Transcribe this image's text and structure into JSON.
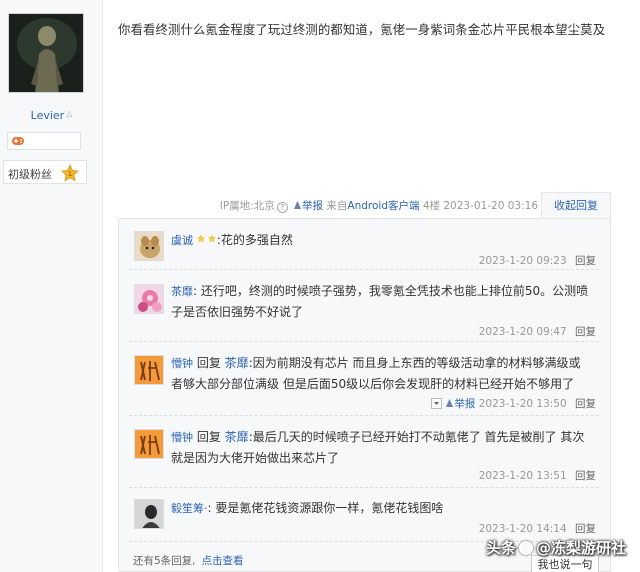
{
  "author": {
    "name": "Levier",
    "name_marker": "△",
    "fan_level": "初级粉丝",
    "fan_badge_number": "1"
  },
  "post": {
    "text": "你看看终测什么氪金程度了玩过终测的都知道，氪佬一身紫词条金芯片平民根本望尘莫及",
    "meta": {
      "ip_label": "IP属地:北京",
      "help_icon": "?",
      "report": "举报",
      "source_prefix": "来自",
      "source_client": "Android客户端",
      "floor": "4楼",
      "timestamp": "2023-01-20 03:16"
    },
    "collapse_label": "收起回复"
  },
  "replies": [
    {
      "user": "虞诚",
      "text": ":花的多强自然",
      "time": "2023-1-20 09:23",
      "reply_label": "回复",
      "has_badges": true
    },
    {
      "user": "茶靡",
      "text_line1": ": 还行吧，终测的时候喷子强势，我零氪全凭技术也能上排位前50。公测喷",
      "text_line2": "子是否依旧强势不好说了",
      "time": "2023-1-20 09:47",
      "reply_label": "回复"
    },
    {
      "user": "懵钟",
      "reply_word": "回复",
      "target": "茶靡",
      "text_line1": ":因为前期没有芯片 而且身上东西的等级活动拿的材料够满级或",
      "text_line2": "者够大部分部位满级 但是后面50级以后你会发现肝的材料已经开始不够用了",
      "report": "举报",
      "time": "2023-1-20 13:50",
      "reply_label": "回复"
    },
    {
      "user": "懵钟",
      "reply_word": "回复",
      "target": "茶靡",
      "text_line1": ":最后几天的时候喷子已经开始打不动氪佬了 首先是被削了 其次",
      "text_line2": "就是因为大佬开始做出来芯片了",
      "time": "2023-1-20 13:51",
      "reply_label": "回复"
    },
    {
      "user": "毅笙筹·",
      "text": ": 要是氪佬花钱资源跟你一样，氪佬花钱图啥",
      "time": "2023-1-20 14:14",
      "reply_label": "回复"
    }
  ],
  "footer": {
    "more_prefix": "还有5条回复,",
    "more_link": "点击查看",
    "say_button": "我也说一句"
  },
  "watermark": {
    "left": "头条",
    "at": "@",
    "right": "冻梨游研社"
  }
}
